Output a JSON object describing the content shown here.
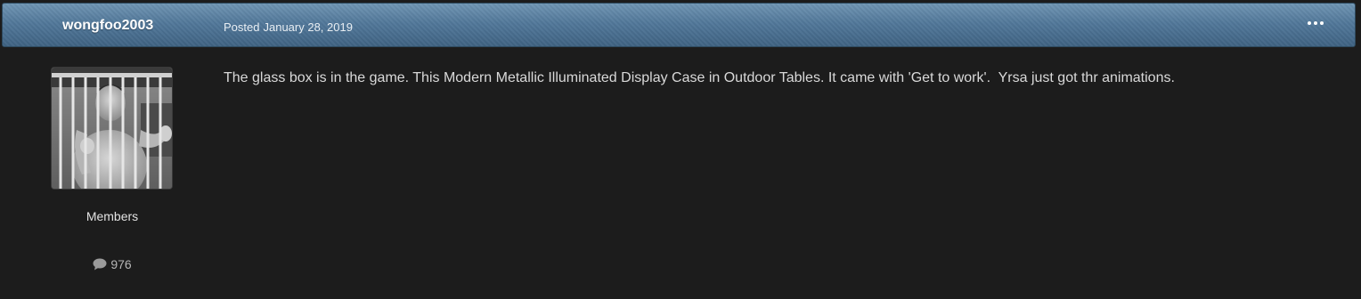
{
  "post": {
    "author": "wongfoo2003",
    "posted_label": "Posted",
    "date": "January 28, 2019",
    "more_icon": "ellipsis-icon",
    "member_group": "Members",
    "post_count": "976",
    "post_count_icon": "comment-icon",
    "avatar_icon": "user-avatar",
    "body": "The glass box is in the game. This Modern Metallic Illuminated Display Case in Outdoor Tables. It came with 'Get to work'.  Yrsa just got thr animations."
  },
  "colors": {
    "background": "#1c1c1c",
    "header": "#52789a",
    "text": "#d9d9d9"
  }
}
